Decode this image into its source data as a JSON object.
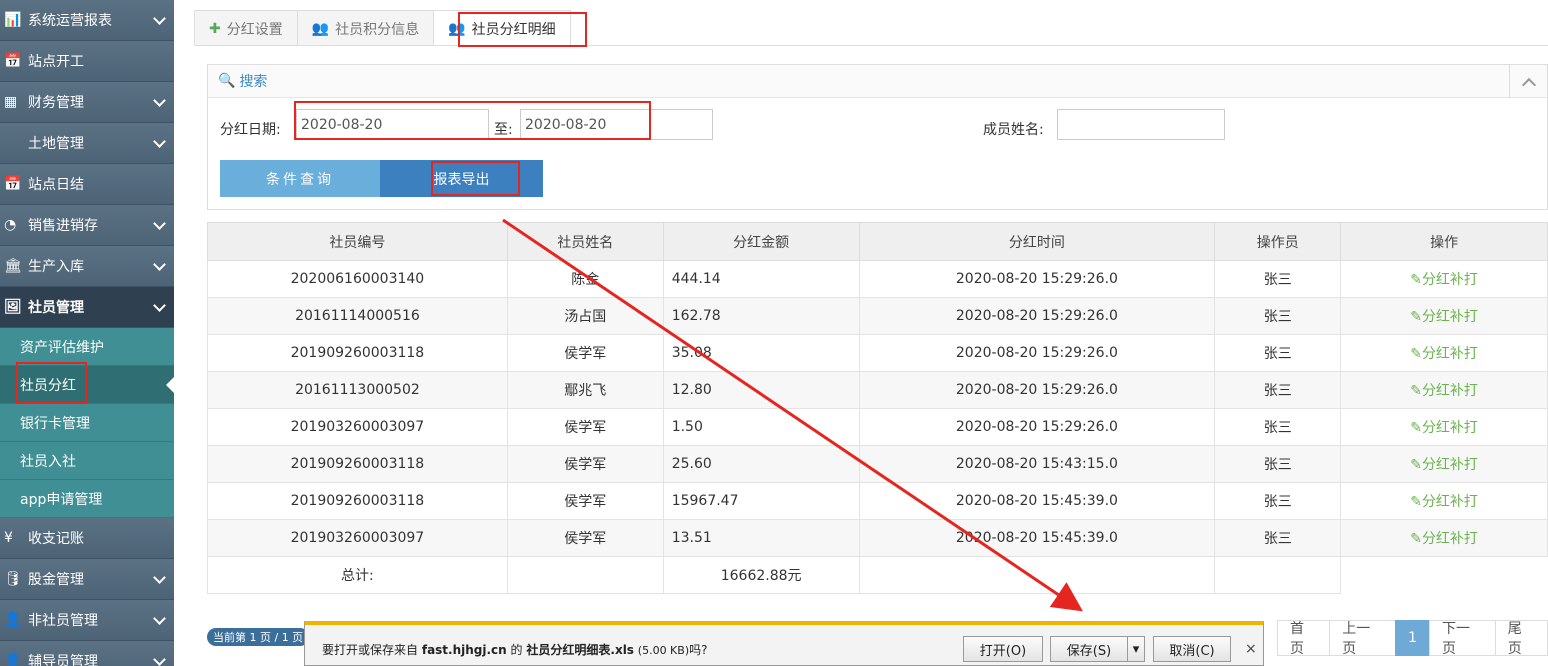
{
  "sidebar": {
    "items": [
      {
        "label": "系统运营报表",
        "icon": "bar-chart-icon"
      },
      {
        "label": "站点开工",
        "icon": "calendar-icon"
      },
      {
        "label": "财务管理",
        "icon": "calculator-icon"
      },
      {
        "label": "土地管理",
        "icon": "land-icon"
      },
      {
        "label": "站点日结",
        "icon": "calendar-icon"
      },
      {
        "label": "销售进销存",
        "icon": "pie-chart-icon"
      },
      {
        "label": "生产入库",
        "icon": "bank-icon"
      },
      {
        "label": "社员管理",
        "icon": "picture-icon"
      }
    ],
    "sub_items": [
      {
        "label": "资产评估维护"
      },
      {
        "label": "社员分红"
      },
      {
        "label": "银行卡管理"
      },
      {
        "label": "社员入社"
      },
      {
        "label": "app申请管理"
      }
    ],
    "bottom_items": [
      {
        "label": "收支记账",
        "icon": "yen-icon"
      },
      {
        "label": "股金管理",
        "icon": "database-icon"
      },
      {
        "label": "非社员管理",
        "icon": "person-icon"
      },
      {
        "label": "辅导员管理",
        "icon": "person-icon"
      }
    ]
  },
  "tabs": [
    {
      "label": "分红设置",
      "icon": "plus-icon"
    },
    {
      "label": "社员积分信息",
      "icon": "users-icon"
    },
    {
      "label": "社员分红明细",
      "icon": "users-icon"
    }
  ],
  "search": {
    "title": "搜索",
    "date_label": "分红日期:",
    "date_from": "2020-08-20",
    "to_label": "至:",
    "date_to": "2020-08-20",
    "name_label": "成员姓名:",
    "name_value": "",
    "query_button": "条件查询",
    "export_button": "报表导出"
  },
  "table": {
    "headers": [
      "社员编号",
      "社员姓名",
      "分红金额",
      "分红时间",
      "操作员",
      "操作"
    ],
    "rows": [
      [
        "202006160003140",
        "陈金",
        "444.14",
        "2020-08-20 15:29:26.0",
        "张三",
        "分红补打"
      ],
      [
        "20161114000516",
        "汤占国",
        "162.78",
        "2020-08-20 15:29:26.0",
        "张三",
        "分红补打"
      ],
      [
        "201909260003118",
        "侯学军",
        "35.08",
        "2020-08-20 15:29:26.0",
        "张三",
        "分红补打"
      ],
      [
        "20161113000502",
        "鄢兆飞",
        "12.80",
        "2020-08-20 15:29:26.0",
        "张三",
        "分红补打"
      ],
      [
        "201903260003097",
        "侯学军",
        "1.50",
        "2020-08-20 15:29:26.0",
        "张三",
        "分红补打"
      ],
      [
        "201909260003118",
        "侯学军",
        "25.60",
        "2020-08-20 15:43:15.0",
        "张三",
        "分红补打"
      ],
      [
        "201909260003118",
        "侯学军",
        "15967.47",
        "2020-08-20 15:45:39.0",
        "张三",
        "分红补打"
      ],
      [
        "201903260003097",
        "侯学军",
        "13.51",
        "2020-08-20 15:45:39.0",
        "张三",
        "分红补打"
      ]
    ],
    "total_label": "总计:",
    "total_value": "16662.88元"
  },
  "pager": {
    "info": "当前第 1 页 / 1 页",
    "first": "首页",
    "prev": "上一页",
    "current": "1",
    "next": "下一页",
    "last": "尾页"
  },
  "download_bar": {
    "prefix": "要打开或保存来自",
    "host": "fast.hjhgj.cn",
    "mid": "的",
    "filename": "社员分红明细表.xls",
    "size": "(5.00 KB)",
    "suffix": "吗?",
    "open": "打开(O)",
    "save": "保存(S)",
    "cancel": "取消(C)",
    "close": "×"
  },
  "colors": {
    "sidebar_bg": "#4a6072",
    "sub_bg": "#3f8f94",
    "query_btn": "#6aaedb",
    "export_btn": "#3d80c0",
    "annotation_red": "#e52520",
    "download_accent": "#f0b400"
  }
}
